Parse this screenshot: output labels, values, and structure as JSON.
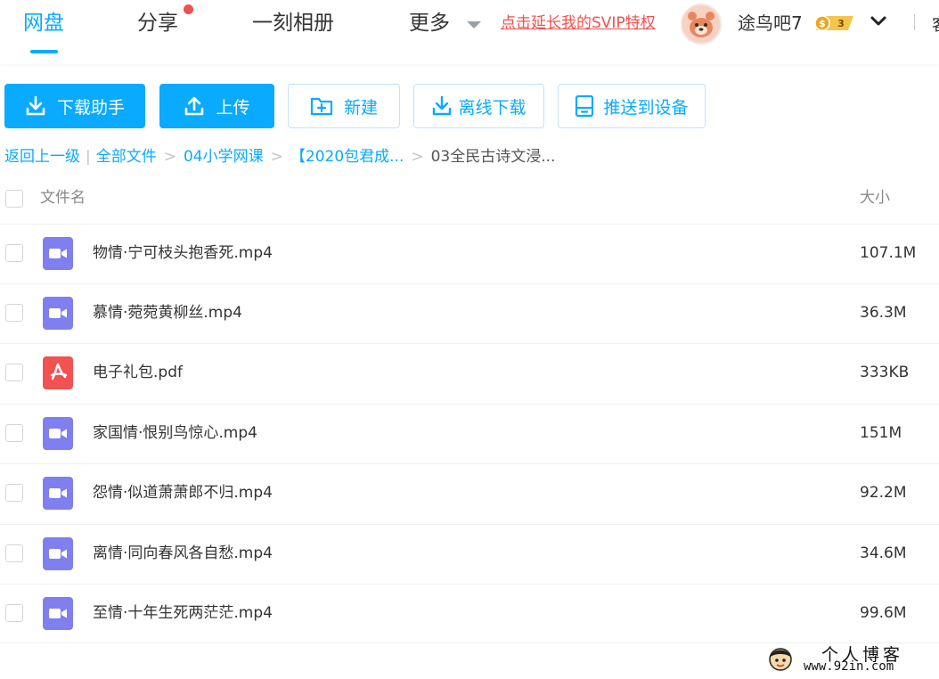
{
  "nav": {
    "items": [
      "网盘",
      "分享",
      "一刻相册",
      "更多"
    ],
    "active_index": 0,
    "svip_link": "点击延长我的SVIP特权",
    "username": "途鸟吧7",
    "vip_level": "3",
    "partial_item": "客"
  },
  "toolbar": {
    "download_helper": "下载助手",
    "upload": "上传",
    "new": "新建",
    "offline_download": "离线下载",
    "push_to_device": "推送到设备"
  },
  "breadcrumb": {
    "back": "返回上一级",
    "items": [
      "全部文件",
      "04小学网课",
      "【2020包君成...",
      "03全民古诗文浸..."
    ]
  },
  "table": {
    "header_name": "文件名",
    "header_size": "大小",
    "rows": [
      {
        "name": "物情·宁可枝头抱香死.mp4",
        "size": "107.1M",
        "type": "video"
      },
      {
        "name": "慕情·菀菀黄柳丝.mp4",
        "size": "36.3M",
        "type": "video"
      },
      {
        "name": "电子礼包.pdf",
        "size": "333KB",
        "type": "pdf"
      },
      {
        "name": "家国情·恨别鸟惊心.mp4",
        "size": "151M",
        "type": "video"
      },
      {
        "name": "怨情·似道萧萧郎不归.mp4",
        "size": "92.2M",
        "type": "video"
      },
      {
        "name": "离情·同向春风各自愁.mp4",
        "size": "34.6M",
        "type": "video"
      },
      {
        "name": "至情·十年生死两茫茫.mp4",
        "size": "99.6M",
        "type": "video"
      }
    ]
  },
  "watermark": {
    "line1": "个人博客",
    "line2": "www.92in.com"
  },
  "colors": {
    "accent": "#09aaff",
    "danger": "#f0504f",
    "video_icon": "#7f7ff0",
    "pdf_icon": "#f25252"
  }
}
